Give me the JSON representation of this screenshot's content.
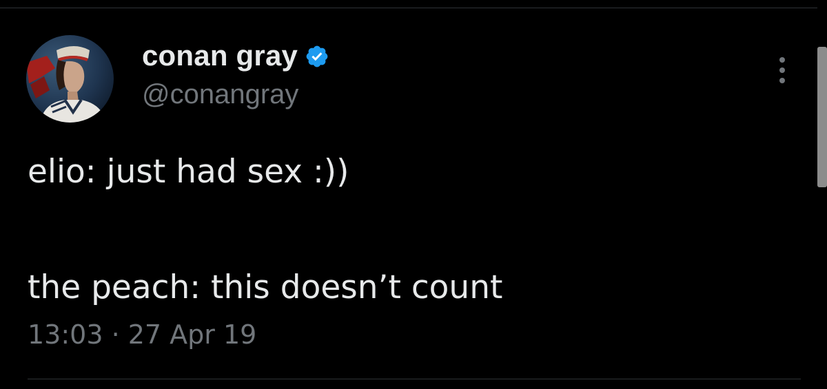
{
  "author": {
    "display_name": "conan gray",
    "handle": "@conangray",
    "verified": true,
    "avatar_icon": "profile-photo"
  },
  "tweet": {
    "line_1": "elio: just had sex :))",
    "line_2": "the peach: this doesn’t count",
    "timestamp": "13:03 · 27 Apr 19"
  },
  "colors": {
    "background": "#000000",
    "text_primary": "#e7e9ea",
    "text_secondary": "#71767b",
    "verified_badge": "#1d9bf0",
    "divider": "#2f3336"
  }
}
